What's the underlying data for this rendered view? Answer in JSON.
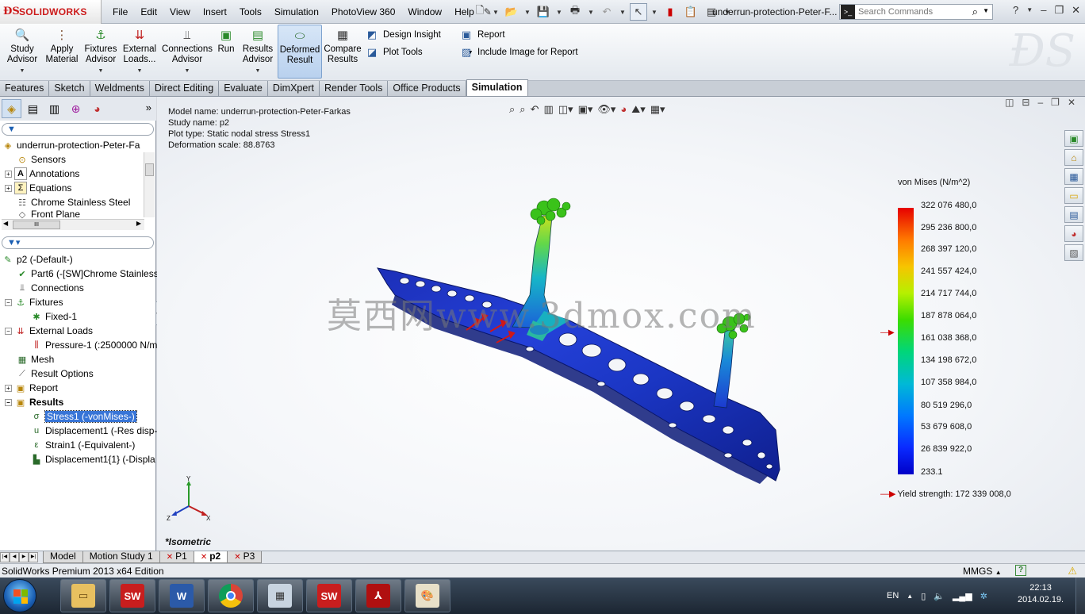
{
  "app": {
    "brand": "SOLIDWORKS",
    "document_title": "underrun-protection-Peter-F...",
    "menu": [
      "File",
      "Edit",
      "View",
      "Insert",
      "Tools",
      "Simulation",
      "PhotoView 360",
      "Window",
      "Help"
    ],
    "search_placeholder": "Search Commands"
  },
  "ribbon": {
    "study_advisor": "Study Advisor",
    "apply_material": "Apply Material",
    "fixtures_advisor": "Fixtures Advisor",
    "external_loads": "External Loads...",
    "connections_advisor": "Connections Advisor",
    "run": "Run",
    "results_advisor": "Results Advisor",
    "deformed_result": "Deformed Result",
    "compare_results": "Compare Results",
    "design_insight": "Design Insight",
    "plot_tools": "Plot Tools",
    "report": "Report",
    "include_image": "Include Image for Report"
  },
  "tabs": [
    "Features",
    "Sketch",
    "Weldments",
    "Direct Editing",
    "Evaluate",
    "DimXpert",
    "Render Tools",
    "Office Products",
    "Simulation"
  ],
  "feature_tree": {
    "root": "underrun-protection-Peter-Fa",
    "items": [
      "Sensors",
      "Annotations",
      "Equations",
      "Chrome Stainless Steel",
      "Front Plane"
    ]
  },
  "study_tree": {
    "study": "p2 (-Default-)",
    "part": "Part6 (-[SW]Chrome Stainless",
    "connections": "Connections",
    "fixtures": "Fixtures",
    "fixed": "Fixed-1",
    "external_loads": "External Loads",
    "pressure": "Pressure-1 (:2500000 N/m",
    "mesh": "Mesh",
    "result_options": "Result Options",
    "report": "Report",
    "results": "Results",
    "stress": "Stress1 (-vonMises-)",
    "displacement": "Displacement1 (-Res disp-",
    "strain": "Strain1 (-Equivalent-)",
    "displacement2": "Displacement1{1} (-Displa"
  },
  "graphics": {
    "model_name": "Model name: underrun-protection-Peter-Farkas",
    "study_name": "Study name: p2",
    "plot_type": "Plot type: Static nodal stress Stress1",
    "deformation_scale": "Deformation scale: 88.8763",
    "view_name": "*Isometric",
    "watermark": "莫西网www.3dmox.com",
    "triad_x": "X",
    "triad_y": "Y",
    "triad_z": "Z"
  },
  "legend": {
    "title": "von Mises (N/m^2)",
    "values": [
      "322 076 480,0",
      "295 236 800,0",
      "268 397 120,0",
      "241 557 424,0",
      "214 717 744,0",
      "187 878 064,0",
      "161 038 368,0",
      "134 198 672,0",
      "107 358 984,0",
      "80 519 296,0",
      "53 679 608,0",
      "26 839 922,0",
      "233.1"
    ],
    "yield_strength": "Yield strength: 172 339 008,0"
  },
  "sheet_tabs": [
    "Model",
    "Motion Study 1",
    "P1",
    "p2",
    "P3"
  ],
  "status": {
    "edition": "SolidWorks Premium 2013 x64 Edition",
    "units": "MMGS",
    "units_caret": "▲"
  },
  "taskbar": {
    "language": "EN",
    "time": "22:13",
    "date": "2014.02.19."
  }
}
